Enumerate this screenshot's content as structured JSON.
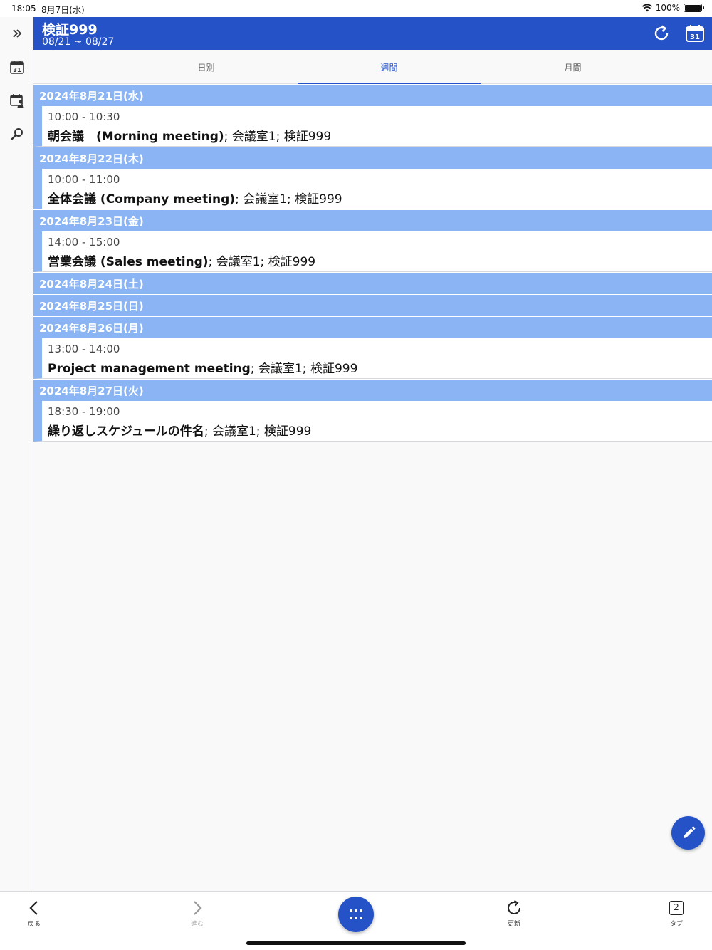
{
  "status_bar": {
    "time": "18:05",
    "date": "8月7日(水)",
    "battery": "100%"
  },
  "header": {
    "title": "検証999",
    "range": "08/21 ~ 08/27",
    "calendar_day": "31"
  },
  "sidebar": {
    "calendar_day": "31"
  },
  "tabs": [
    {
      "label": "日別",
      "active": false
    },
    {
      "label": "週間",
      "active": true
    },
    {
      "label": "月間",
      "active": false
    }
  ],
  "days": [
    {
      "date": "2024年8月21日(水)",
      "events": [
        {
          "time": "10:00 - 10:30",
          "title": "朝会議　(Morning meeting)",
          "detail": "; 会議室1; 検証999"
        }
      ]
    },
    {
      "date": "2024年8月22日(木)",
      "events": [
        {
          "time": "10:00 - 11:00",
          "title": "全体会議 (Company meeting)",
          "detail": "; 会議室1; 検証999"
        }
      ]
    },
    {
      "date": "2024年8月23日(金)",
      "events": [
        {
          "time": "14:00 - 15:00",
          "title": "営業会議 (Sales meeting)",
          "detail": "; 会議室1; 検証999"
        }
      ]
    },
    {
      "date": "2024年8月24日(土)",
      "events": []
    },
    {
      "date": "2024年8月25日(日)",
      "events": []
    },
    {
      "date": "2024年8月26日(月)",
      "events": [
        {
          "time": "13:00 - 14:00",
          "title": "Project management meeting",
          "detail": "; 会議室1; 検証999"
        }
      ]
    },
    {
      "date": "2024年8月27日(火)",
      "events": [
        {
          "time": "18:30 - 19:00",
          "title": "繰り返しスケジュールの件名",
          "detail": "; 会議室1; 検証999"
        }
      ]
    }
  ],
  "bottom_bar": {
    "back": "戻る",
    "forward": "進む",
    "refresh": "更新",
    "tabs": "タブ",
    "tab_count": "2"
  },
  "colors": {
    "primary": "#2553c7",
    "day_header": "#8ab4f3"
  }
}
